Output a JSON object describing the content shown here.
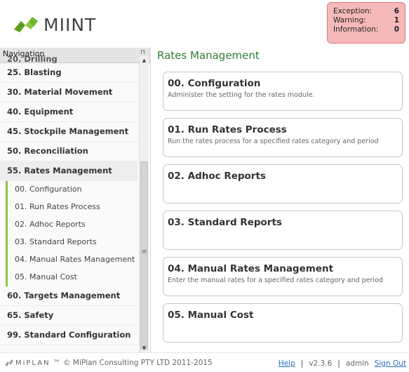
{
  "app": {
    "logo_text": "MIINT",
    "footer_brand": "MiPLAN",
    "footer_tm": "™",
    "copyright": "© MiPlan Consulting PTY LTD 2011-2015",
    "help_label": "Help",
    "version": "v2.3.6",
    "user": "admin",
    "signout_label": "Sign Out"
  },
  "status": {
    "exception_label": "Exception:",
    "exception_count": "6",
    "warning_label": "Warning:",
    "warning_count": "1",
    "information_label": "Information:",
    "information_count": "0",
    "colors": {
      "background": "#f6b9b9",
      "border": "#d97b7b"
    }
  },
  "nav": {
    "header": "Navigation",
    "pin_glyph": "⊓",
    "partial_item": "20. Drilling",
    "items": [
      {
        "label": "25. Blasting"
      },
      {
        "label": "30. Material Movement"
      },
      {
        "label": "40. Equipment"
      },
      {
        "label": "45. Stockpile Management"
      },
      {
        "label": "50. Reconciliation"
      },
      {
        "label": "55. Rates Management"
      }
    ],
    "subitems": [
      {
        "label": "00. Configuration"
      },
      {
        "label": "01. Run Rates Process"
      },
      {
        "label": "02. Adhoc Reports"
      },
      {
        "label": "03. Standard Reports"
      },
      {
        "label": "04. Manual Rates Management"
      },
      {
        "label": "05. Manual Cost"
      }
    ],
    "items_after": [
      {
        "label": "60. Targets Management"
      },
      {
        "label": "65. Safety"
      },
      {
        "label": "99. Standard Configuration"
      }
    ],
    "accent_color": "#8cc63f"
  },
  "main": {
    "title": "Rates Management",
    "title_color": "#2e7d32",
    "cards": [
      {
        "title": "00. Configuration",
        "desc": "Administer the setting for the rates module."
      },
      {
        "title": "01. Run Rates Process",
        "desc": "Run the rates process for a specified rates category and period"
      },
      {
        "title": "02. Adhoc Reports",
        "desc": ""
      },
      {
        "title": "03. Standard Reports",
        "desc": ""
      },
      {
        "title": "04. Manual Rates Management",
        "desc": "Enter the manual rates for a specified rates category and period"
      },
      {
        "title": "05. Manual Cost",
        "desc": ""
      }
    ]
  }
}
